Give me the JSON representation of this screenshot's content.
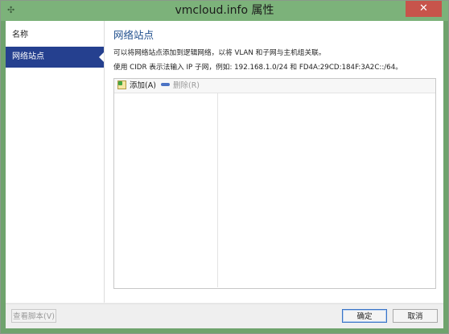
{
  "window": {
    "title": "vmcloud.info 属性",
    "close_glyph": "✕",
    "app_icon": "network-icon"
  },
  "sidebar": {
    "items": [
      {
        "label": "名称",
        "active": false
      },
      {
        "label": "网络站点",
        "active": true
      }
    ]
  },
  "main": {
    "title": "网络站点",
    "description_1": "可以将网络站点添加到逻辑网络，以将 VLAN 和子网与主机组关联。",
    "description_2": "使用 CIDR 表示法输入 IP 子网，例如: 192.168.1.0/24 和 FD4A:29CD:184F:3A2C::/64。",
    "toolbar": {
      "add_label": "添加(A)",
      "delete_label": "删除(R)"
    }
  },
  "footer": {
    "view_script_label": "查看脚本(V)",
    "ok_label": "确定",
    "cancel_label": "取消"
  },
  "colors": {
    "accent": "#25408f",
    "title_bar": "#7cb27a",
    "close_button": "#c7544b",
    "page_title": "#1f4e8c"
  }
}
